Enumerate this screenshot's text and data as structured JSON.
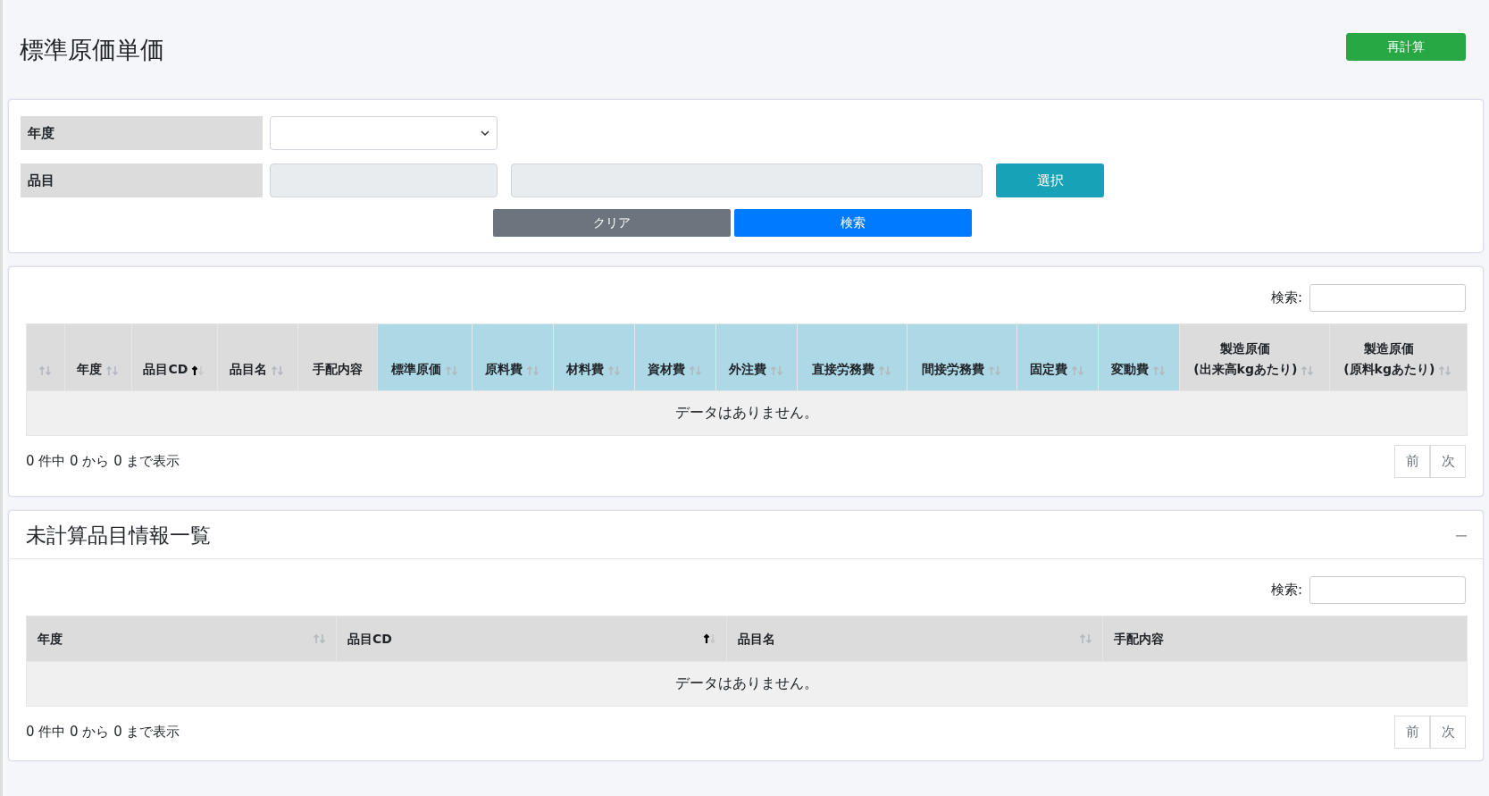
{
  "page_title": "標準原価単価",
  "recalc_button": "再計算",
  "filter": {
    "year": {
      "label": "年度"
    },
    "item": {
      "label": "品目"
    },
    "select_button": "選択",
    "clear_button": "クリア",
    "search_button": "検索"
  },
  "cost_table": {
    "search_label": "検索:",
    "columns": [
      {
        "sortable": true,
        "sorted_ascending": false,
        "highlight": false
      },
      {
        "label": "年度",
        "sortable": true,
        "sorted_ascending": false,
        "highlight": false
      },
      {
        "label": "品目CD",
        "sortable": true,
        "sorted_ascending": true,
        "highlight": false
      },
      {
        "label": "品目名",
        "sortable": true,
        "sorted_ascending": false,
        "highlight": false
      },
      {
        "label": "手配内容",
        "sortable": false,
        "sorted_ascending": false,
        "highlight": false
      },
      {
        "label": "標準原価",
        "sortable": true,
        "sorted_ascending": false,
        "highlight": true
      },
      {
        "label": "原料費",
        "sortable": true,
        "sorted_ascending": false,
        "highlight": true
      },
      {
        "label": "材料費",
        "sortable": true,
        "sorted_ascending": false,
        "highlight": true
      },
      {
        "label": "資材費",
        "sortable": true,
        "sorted_ascending": false,
        "highlight": true
      },
      {
        "label": "外注費",
        "sortable": true,
        "sorted_ascending": false,
        "highlight": true
      },
      {
        "label": "直接労務費",
        "sortable": true,
        "sorted_ascending": false,
        "highlight": true
      },
      {
        "label": "間接労務費",
        "sortable": true,
        "sorted_ascending": false,
        "highlight": true
      },
      {
        "label": "固定費",
        "sortable": true,
        "sorted_ascending": false,
        "highlight": true
      },
      {
        "label": "変動費",
        "sortable": true,
        "sorted_ascending": false,
        "highlight": true
      },
      {
        "label": "製造原価\n(出来高kgあたり)",
        "sortable": true,
        "sorted_ascending": false,
        "highlight": false
      },
      {
        "label": "製造原価\n(原料kgあたり)",
        "sortable": true,
        "sorted_ascending": false,
        "highlight": false
      }
    ],
    "empty_message": "データはありません。",
    "info": "0 件中 0 から 0 まで表示",
    "prev": "前",
    "next": "次"
  },
  "uncalculated": {
    "title": "未計算品目情報一覧",
    "search_label": "検索:",
    "columns": [
      {
        "label": "年度",
        "sortable": true,
        "sorted_ascending": false,
        "highlight": false
      },
      {
        "label": "品目CD",
        "sortable": true,
        "sorted_ascending": true,
        "highlight": false
      },
      {
        "label": "品目名",
        "sortable": true,
        "sorted_ascending": false,
        "highlight": false
      },
      {
        "label": "手配内容",
        "sortable": false,
        "sorted_ascending": false,
        "highlight": false
      }
    ],
    "empty_message": "データはありません。",
    "info": "0 件中 0 から 0 まで表示",
    "prev": "前",
    "next": "次"
  }
}
